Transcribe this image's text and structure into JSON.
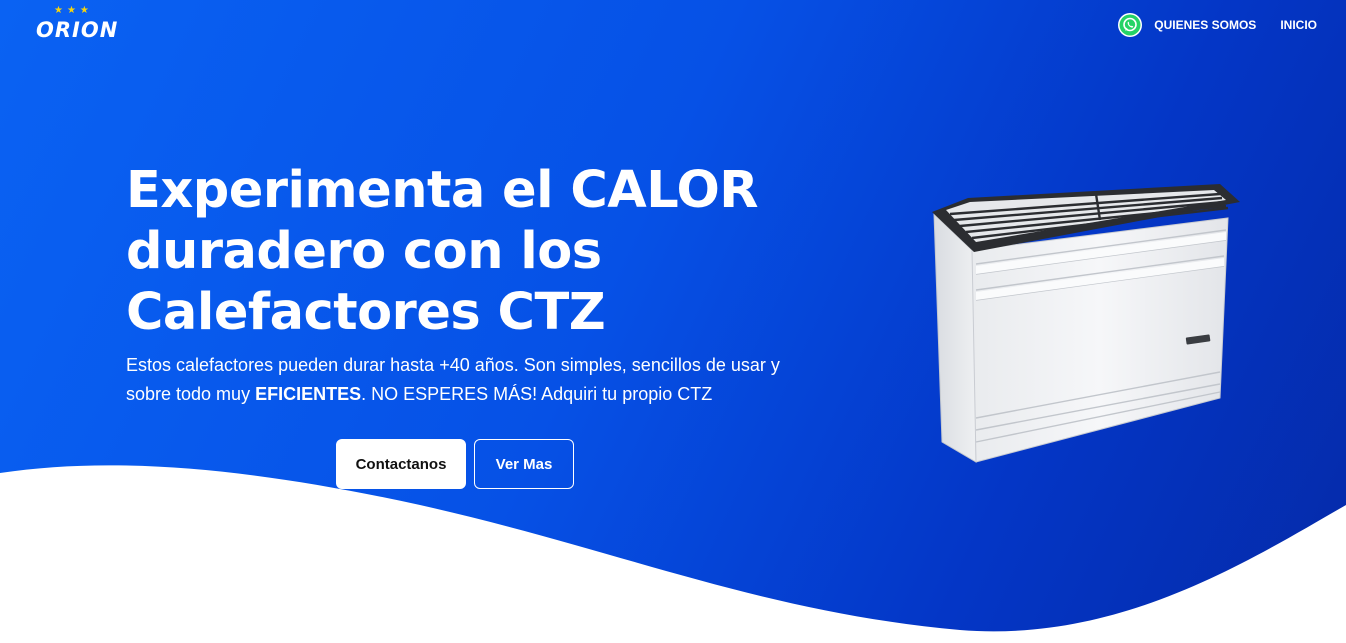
{
  "brand": {
    "name": "ORION",
    "stars": "★★★"
  },
  "nav": {
    "whatsapp_icon": "whatsapp-icon",
    "items": [
      {
        "label": "QUIENES SOMOS"
      },
      {
        "label": "INICIO"
      }
    ]
  },
  "hero": {
    "title_line1": "Experimenta el CALOR",
    "title_line2": "duradero con los",
    "title_line3": "Calefactores CTZ",
    "desc_part1": "Estos calefactores pueden durar hasta +40 años. Son simples, sencillos de usar y sobre todo muy ",
    "desc_bold": "EFICIENTES",
    "desc_part2": ". NO ESPERES MÁS! Adquiri tu propio CTZ",
    "primary_button": "Contactanos",
    "secondary_button": "Ver Mas",
    "image": "heater-product-image"
  },
  "colors": {
    "gradient_start": "#0a62f3",
    "gradient_end": "#052aa8",
    "whatsapp_green": "#25d366",
    "star_yellow": "#f5d410",
    "text": "#ffffff"
  }
}
